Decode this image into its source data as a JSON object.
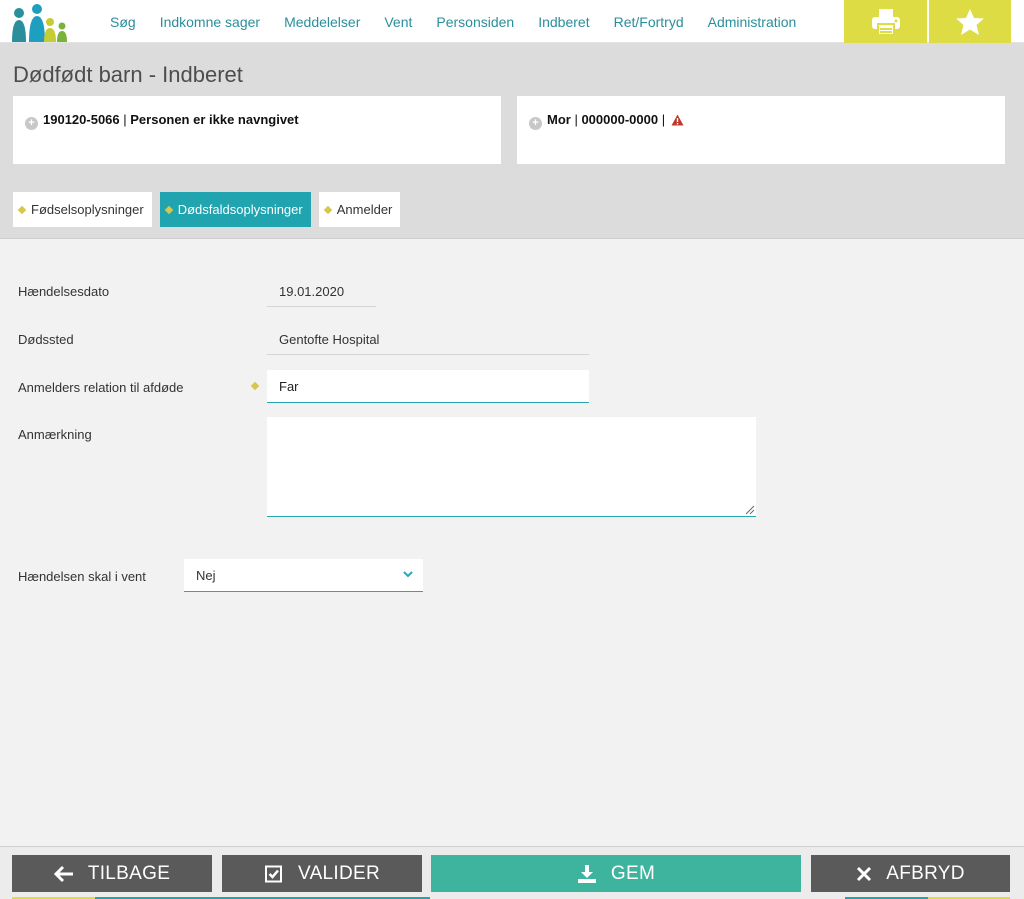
{
  "nav": {
    "items": [
      "Søg",
      "Indkomne sager",
      "Meddelelser",
      "Vent",
      "Personsiden",
      "Indberet",
      "Ret/Fortryd",
      "Administration"
    ]
  },
  "header": {
    "title": "Dødfødt barn - Indberet",
    "child_card": {
      "cpr": "190120-5066",
      "separator": " | ",
      "name": "Personen er ikke navngivet"
    },
    "mother_card": {
      "label": "Mor",
      "separator": " | ",
      "cpr": "000000-0000",
      "trail": " |"
    }
  },
  "tabs": [
    {
      "label": "Fødselsoplysninger",
      "active": false
    },
    {
      "label": "Dødsfaldsoplysninger",
      "active": true
    },
    {
      "label": "Anmelder",
      "active": false
    }
  ],
  "form": {
    "event_date_label": "Hændelsesdato",
    "event_date_value": "19.01.2020",
    "place_label": "Dødssted",
    "place_value": "Gentofte Hospital",
    "relation_label": "Anmelders relation til afdøde",
    "relation_value": "Far",
    "remark_label": "Anmærkning",
    "remark_value": "",
    "wait_label": "Hændelsen skal i vent",
    "wait_value": "Nej"
  },
  "bottom": {
    "back": "TILBAGE",
    "validate": "VALIDER",
    "save": "GEM",
    "cancel": "AFBRYD"
  },
  "colors": {
    "accent_teal": "#1fa4b0",
    "save_green": "#3eb49f",
    "yellow": "#dddc45",
    "dark_button": "#5a5a5a",
    "warning": "#c0392b"
  },
  "icons": {
    "print": "printer-icon",
    "star": "star-icon",
    "back": "arrow-left-icon",
    "validate": "checkbox-icon",
    "save": "download-icon",
    "cancel": "close-icon",
    "warning": "warning-icon",
    "expand": "plus-circle-icon"
  }
}
